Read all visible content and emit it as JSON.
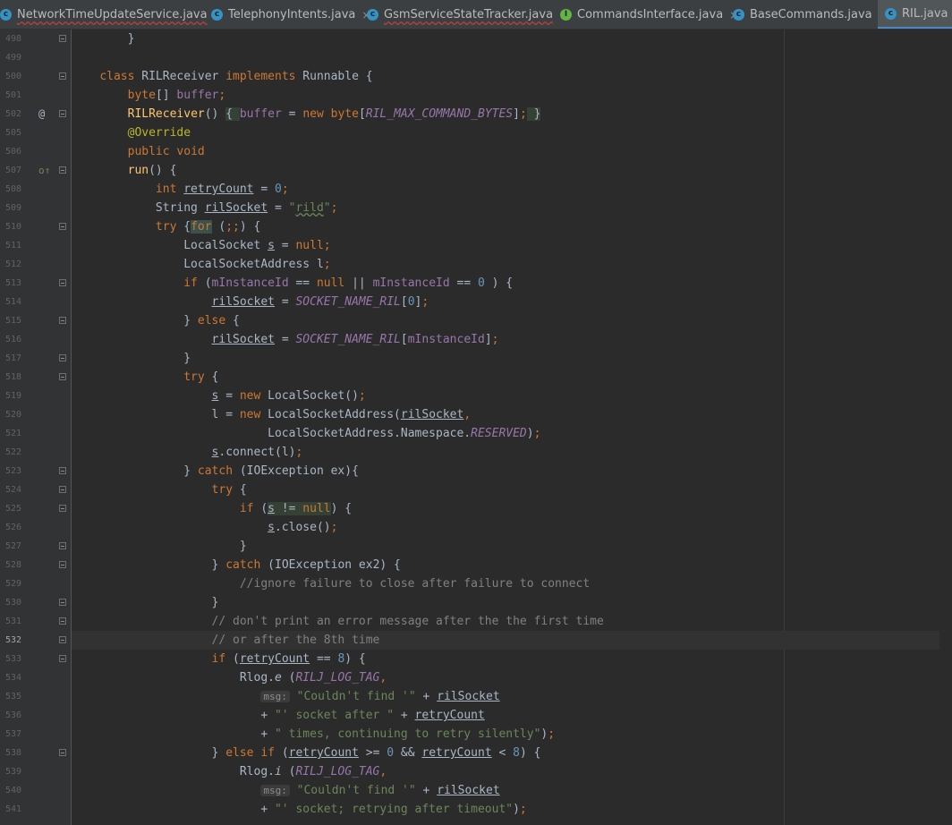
{
  "tabs": [
    {
      "label": "NetworkTimeUpdateService.java",
      "icon": "class-icon",
      "active": false,
      "error": true
    },
    {
      "label": "TelephonyIntents.java",
      "icon": "class-icon",
      "active": false,
      "error": false
    },
    {
      "label": "GsmServiceStateTracker.java",
      "icon": "class-icon",
      "active": false,
      "error": true
    },
    {
      "label": "CommandsInterface.java",
      "icon": "interface-icon",
      "active": false,
      "error": false
    },
    {
      "label": "BaseCommands.java",
      "icon": "class-icon",
      "active": false,
      "error": false
    },
    {
      "label": "RIL.java",
      "icon": "class-icon",
      "active": true,
      "error": false
    }
  ],
  "close_glyph": "×",
  "gutter_marks": {
    "at": "@",
    "override": "o↑"
  },
  "inlay_hint": "msg:",
  "line_numbers": [
    "498",
    "499",
    "500",
    "501",
    "502",
    "505",
    "506",
    "507",
    "508",
    "509",
    "510",
    "511",
    "512",
    "513",
    "514",
    "515",
    "516",
    "517",
    "518",
    "519",
    "520",
    "521",
    "522",
    "523",
    "524",
    "525",
    "526",
    "527",
    "528",
    "529",
    "530",
    "531",
    "532",
    "533",
    "534",
    "535",
    "536",
    "537",
    "538",
    "539",
    "540",
    "541"
  ],
  "current_line": "532",
  "colors": {
    "keyword": "#cc7832",
    "field": "#9876aa",
    "number": "#6897bb",
    "string": "#6a8759",
    "comment": "#808080",
    "annotation": "#bbb529",
    "method": "#ffc66d",
    "text": "#a9b7c6"
  },
  "code": {
    "l498": "}",
    "l500_kw1": "class ",
    "l500_name": "RILReceiver ",
    "l500_kw2": "implements ",
    "l500_rest": "Runnable {",
    "l501_type": "byte",
    "l501_rest": "[] ",
    "l501_field": "buffer",
    "l501_semi": ";",
    "l502_ctor": "RILReceiver",
    "l502_a": "() ",
    "l502_b": "{ ",
    "l502_field": "buffer",
    "l502_c": " = ",
    "l502_new": "new ",
    "l502_byte": "byte",
    "l502_d": "[",
    "l502_const": "RIL_MAX_COMMAND_BYTES",
    "l502_e": "]",
    "l502_semi": ";",
    "l502_f": " }",
    "l505": "@Override",
    "l506": "public void",
    "l507_m": "run",
    "l507_rest": "() {",
    "l508_kw": "int ",
    "l508_var": "retryCount",
    "l508_a": " = ",
    "l508_n": "0",
    "l508_semi": ";",
    "l509_a": "String ",
    "l509_var": "rilSocket",
    "l509_b": " = ",
    "l509_s1": "\"",
    "l509_s2": "rild",
    "l509_s3": "\"",
    "l509_semi": ";",
    "l510_try": "try ",
    "l510_brace": "{",
    "l510_for": "for",
    "l510_a": " (",
    "l510_semis": ";;",
    "l510_b": ") {",
    "l511_a": "LocalSocket ",
    "l511_var": "s",
    "l511_b": " = ",
    "l511_null": "null",
    "l511_semi": ";",
    "l512_a": "LocalSocketAddress l",
    "l512_semi": ";",
    "l513_if": "if ",
    "l513_a": "(",
    "l513_f1": "mInstanceId",
    "l513_b": " == ",
    "l513_null": "null",
    "l513_c": " || ",
    "l513_f2": "mInstanceId",
    "l513_d": " == ",
    "l513_n": "0",
    "l513_e": " ) {",
    "l514_var": "rilSocket",
    "l514_a": " = ",
    "l514_const": "SOCKET_NAME_RIL",
    "l514_b": "[",
    "l514_n": "0",
    "l514_c": "]",
    "l514_semi": ";",
    "l515_a": "} ",
    "l515_else": "else ",
    "l515_b": "{",
    "l516_var": "rilSocket",
    "l516_a": " = ",
    "l516_const": "SOCKET_NAME_RIL",
    "l516_b": "[",
    "l516_f": "mInstanceId",
    "l516_c": "]",
    "l516_semi": ";",
    "l517": "}",
    "l518_try": "try ",
    "l518_b": "{",
    "l519_var": "s",
    "l519_a": " = ",
    "l519_new": "new ",
    "l519_b": "LocalSocket()",
    "l519_semi": ";",
    "l520_a": "l = ",
    "l520_new": "new ",
    "l520_b": "LocalSocketAddress(",
    "l520_var": "rilSocket",
    "l520_comma": ",",
    "l521_a": "LocalSocketAddress.Namespace.",
    "l521_const": "RESERVED",
    "l521_b": ")",
    "l521_semi": ";",
    "l522_var": "s",
    "l522_a": ".connect(l)",
    "l522_semi": ";",
    "l523_a": "} ",
    "l523_catch": "catch ",
    "l523_b": "(IOException ex){",
    "l524_try": "try ",
    "l524_b": "{",
    "l525_if": "if ",
    "l525_a": "(",
    "l525_var": "s",
    "l525_b": " != ",
    "l525_null": "null",
    "l525_c": ")",
    "l525_d": " {",
    "l526_var": "s",
    "l526_a": ".close()",
    "l526_semi": ";",
    "l527": "}",
    "l528_a": "} ",
    "l528_catch": "catch ",
    "l528_b": "(IOException ex2) {",
    "l529": "//ignore failure to close after failure to connect",
    "l530": "}",
    "l531": "// don't print an error message after the the first time",
    "l532": "// or after the 8th time",
    "l533_if": "if ",
    "l533_a": "(",
    "l533_var": "retryCount",
    "l533_b": " == ",
    "l533_n": "8",
    "l533_c": ") {",
    "l534_a": "Rlog.",
    "l534_m": "e",
    "l534_b": " (",
    "l534_const": "RILJ_LOG_TAG",
    "l534_comma": ",",
    "l535_s": "\"Couldn't find '\"",
    "l535_a": " + ",
    "l535_var": "rilSocket",
    "l536_a": "+ ",
    "l536_s": "\"' socket after \"",
    "l536_b": " + ",
    "l536_var": "retryCount",
    "l537_a": "+ ",
    "l537_s": "\" times, continuing to retry silently\"",
    "l537_b": ")",
    "l537_semi": ";",
    "l538_a": "} ",
    "l538_else": "else if ",
    "l538_b": "(",
    "l538_var": "retryCount",
    "l538_c": " >= ",
    "l538_n1": "0",
    "l538_d": " && ",
    "l538_var2": "retryCount",
    "l538_e": " < ",
    "l538_n2": "8",
    "l538_f": ") {",
    "l539_a": "Rlog.",
    "l539_m": "i",
    "l539_b": " (",
    "l539_const": "RILJ_LOG_TAG",
    "l539_comma": ",",
    "l540_s": "\"Couldn't find '\"",
    "l540_a": " + ",
    "l540_var": "rilSocket",
    "l541_a": "+ ",
    "l541_s": "\"' socket; retrying after timeout\"",
    "l541_b": ")",
    "l541_semi": ";"
  }
}
